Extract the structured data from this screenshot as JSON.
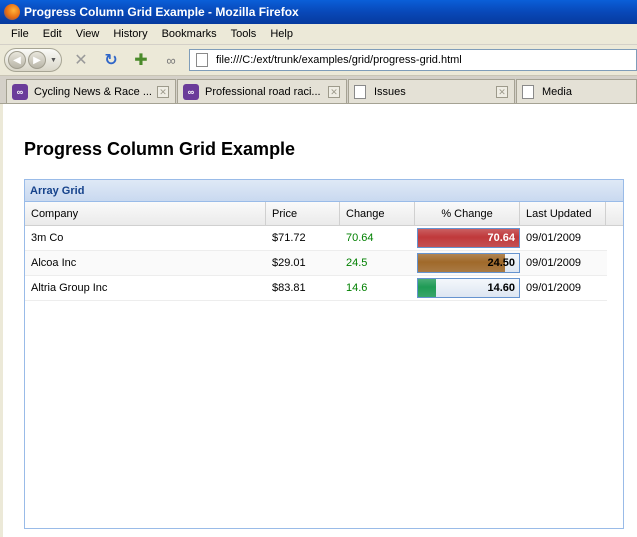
{
  "window": {
    "title": "Progress Column Grid Example - Mozilla Firefox"
  },
  "menu": {
    "items": [
      "File",
      "Edit",
      "View",
      "History",
      "Bookmarks",
      "Tools",
      "Help"
    ]
  },
  "nav": {
    "url": "file:///C:/ext/trunk/examples/grid/progress-grid.html"
  },
  "tabs": [
    {
      "label": "Cycling News & Race ...",
      "icon": "cycling-site-icon"
    },
    {
      "label": "Professional road raci...",
      "icon": "cycling-site-icon"
    },
    {
      "label": "Issues",
      "icon": "page-icon"
    },
    {
      "label": "Media",
      "icon": "page-icon"
    }
  ],
  "page": {
    "heading": "Progress Column Grid Example"
  },
  "grid": {
    "title": "Array Grid",
    "columns": [
      "Company",
      "Price",
      "Change",
      "% Change",
      "Last Updated"
    ],
    "rows": [
      {
        "company": "3m Co",
        "price": "$71.72",
        "change": "70.64",
        "pct_label": "70.64",
        "pct_value": 100,
        "pct_color": "#c0393b",
        "updated": "09/01/2009"
      },
      {
        "company": "Alcoa Inc",
        "price": "$29.01",
        "change": "24.5",
        "pct_label": "24.50",
        "pct_value": 86,
        "pct_color": "#a0692a",
        "updated": "09/01/2009"
      },
      {
        "company": "Altria Group Inc",
        "price": "$83.81",
        "change": "14.6",
        "pct_label": "14.60",
        "pct_value": 18,
        "pct_color": "#1f9b55",
        "updated": "09/01/2009"
      }
    ]
  }
}
